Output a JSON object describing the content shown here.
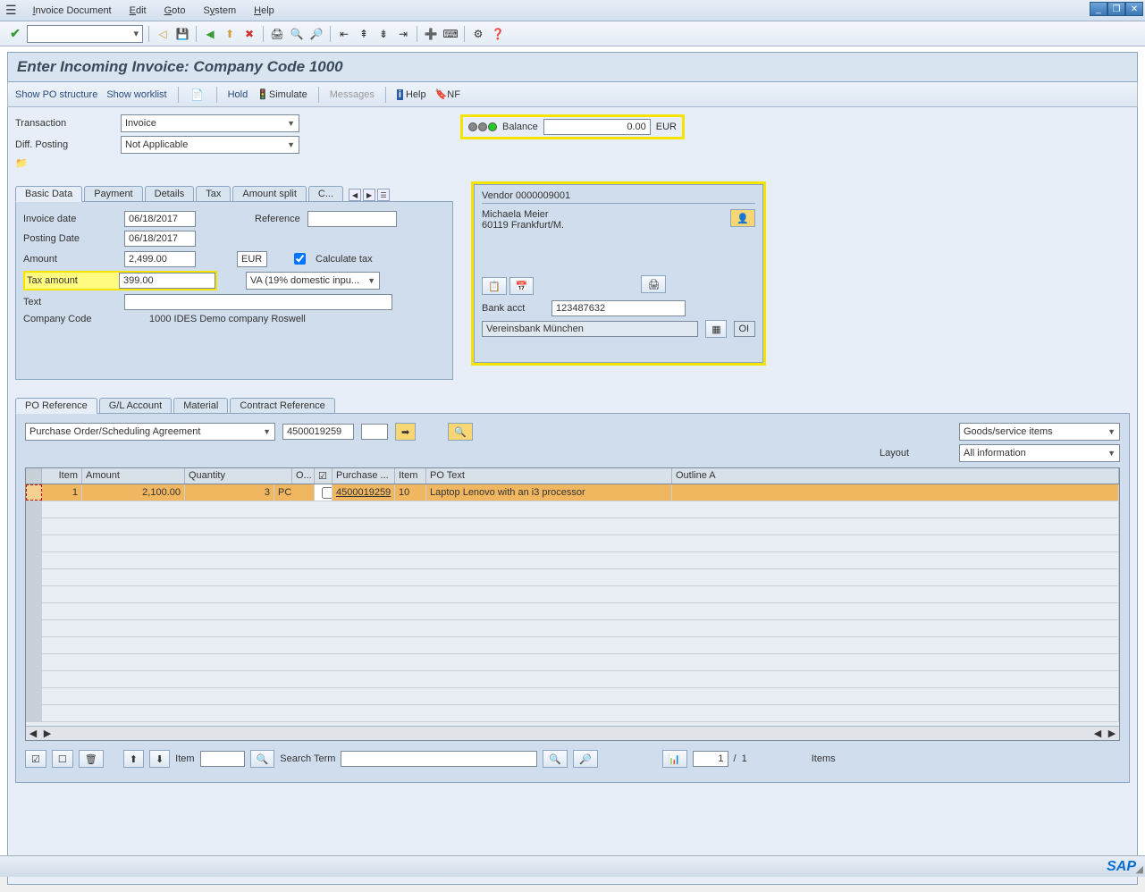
{
  "menubar": {
    "items": [
      "Invoice Document",
      "Edit",
      "Goto",
      "System",
      "Help"
    ]
  },
  "page_title": "Enter Incoming Invoice: Company Code 1000",
  "app_toolbar": {
    "show_po_structure": "Show PO structure",
    "show_worklist": "Show worklist",
    "hold": "Hold",
    "simulate": "Simulate",
    "messages": "Messages",
    "help": "Help",
    "nf": "NF"
  },
  "transaction": {
    "label": "Transaction",
    "value": "Invoice"
  },
  "diff_posting": {
    "label": "Diff. Posting",
    "value": "Not Applicable"
  },
  "balance": {
    "label": "Balance",
    "value": "0.00",
    "currency": "EUR"
  },
  "basic_tabs": [
    "Basic Data",
    "Payment",
    "Details",
    "Tax",
    "Amount split",
    "C..."
  ],
  "basic_data": {
    "invoice_date_label": "Invoice date",
    "invoice_date": "06/18/2017",
    "reference_label": "Reference",
    "reference": "",
    "posting_date_label": "Posting Date",
    "posting_date": "06/18/2017",
    "amount_label": "Amount",
    "amount": "2,499.00",
    "currency": "EUR",
    "calc_tax_label": "Calculate tax",
    "tax_amount_label": "Tax amount",
    "tax_amount": "399.00",
    "tax_code": "VA (19% domestic inpu...",
    "text_label": "Text",
    "text": "",
    "company_code_label": "Company Code",
    "company_code": "1000 IDES Demo company Roswell"
  },
  "vendor": {
    "header": "Vendor 0000009001",
    "name": "Michaela Meier",
    "address": "60119 Frankfurt/M.",
    "bank_acct_label": "Bank acct",
    "bank_acct": "123487632",
    "bank_name": "Vereinsbank München",
    "oi_label": "OI"
  },
  "item_tabs": [
    "PO Reference",
    "G/L Account",
    "Material",
    "Contract Reference"
  ],
  "po_section": {
    "ref_type": "Purchase Order/Scheduling Agreement",
    "po_number": "4500019259",
    "goods_filter": "Goods/service items",
    "layout_label": "Layout",
    "layout_value": "All information"
  },
  "table": {
    "headers": [
      "Item",
      "Amount",
      "Quantity",
      "O...",
      "",
      "Purchase ...",
      "Item",
      "PO Text",
      "Outline A"
    ],
    "row": {
      "item": "1",
      "amount": "2,100.00",
      "quantity": "3",
      "unit": "PC",
      "po": "4500019259",
      "po_item": "10",
      "po_text": "Laptop Lenovo with an i3 processor"
    }
  },
  "bottom": {
    "item_label": "Item",
    "search_term_label": "Search Term",
    "page_current": "1",
    "page_sep": "/",
    "page_total": "1",
    "items_label": "Items"
  },
  "sap_logo": "SAP"
}
